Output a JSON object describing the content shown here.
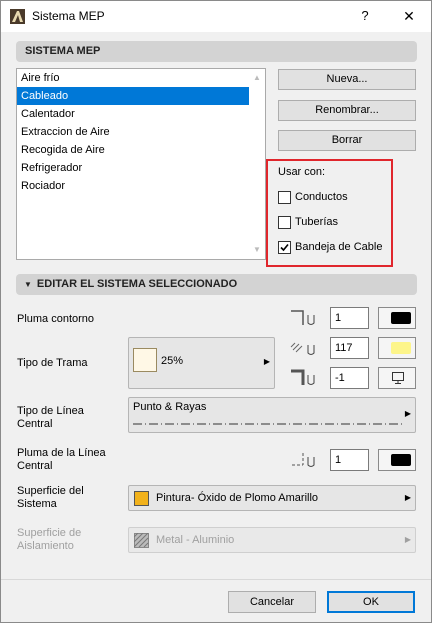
{
  "window": {
    "title": "Sistema MEP",
    "help_label": "?",
    "close_label": "✕"
  },
  "section1": {
    "title": "SISTEMA MEP"
  },
  "systems": {
    "items": [
      "Aire frío",
      "Cableado",
      "Calentador",
      "Extraccion de Aire",
      "Recogida de Aire",
      "Refrigerador",
      "Rociador"
    ],
    "selected_index": 1
  },
  "buttons": {
    "new_label": "Nueva...",
    "rename_label": "Renombrar...",
    "delete_label": "Borrar",
    "cancel_label": "Cancelar",
    "ok_label": "OK"
  },
  "usar_con": {
    "title": "Usar con:",
    "options": [
      {
        "label": "Conductos",
        "checked": false
      },
      {
        "label": "Tuberías",
        "checked": false
      },
      {
        "label": "Bandeja de Cable",
        "checked": true
      }
    ]
  },
  "section2": {
    "title": "EDITAR EL SISTEMA SELECCIONADO"
  },
  "edit": {
    "pluma_contorno": {
      "label": "Pluma contorno",
      "value": "1",
      "color": "#000000"
    },
    "tipo_trama": {
      "label": "Tipo de Trama",
      "pattern_value": "25%",
      "fg_value": "117",
      "fg_color": "#fdf58a",
      "bg_value": "-1"
    },
    "tipo_linea": {
      "label_line1": "Tipo de Línea",
      "label_line2": "Central",
      "value": "Punto & Rayas"
    },
    "pluma_linea": {
      "label_line1": "Pluma de la Línea",
      "label_line2": "Central",
      "value": "1",
      "color": "#000000"
    },
    "superficie_sistema": {
      "label_line1": "Superficie del",
      "label_line2": "Sistema",
      "value": "Pintura- Óxido de Plomo Amarillo",
      "swatch_color": "#f2b21b"
    },
    "superficie_aislamiento": {
      "label_line1": "Superficie de",
      "label_line2": "Aislamiento",
      "value": "Metal - Aluminio"
    }
  }
}
